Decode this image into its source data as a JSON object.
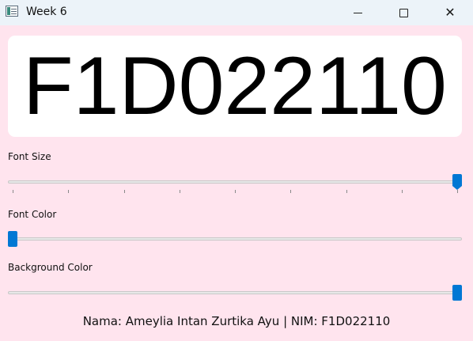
{
  "window": {
    "title": "Week 6",
    "icons": {
      "app": "app-window-icon",
      "minimize": "minimize-icon",
      "maximize": "maximize-icon",
      "close": "close-icon"
    },
    "close_glyph": "✕"
  },
  "display": {
    "text": "F1D022110",
    "text_color": "#000000",
    "background_color": "#ffffff"
  },
  "controls": {
    "font_size": {
      "label": "Font Size",
      "level": 1.0,
      "ticks": 9
    },
    "font_color": {
      "label": "Font Color",
      "level": 0.0
    },
    "background_color": {
      "label": "Background Color",
      "level": 1.0
    }
  },
  "footer": {
    "text": "Nama: Ameylia Intan Zurtika Ayu | NIM: F1D022110"
  },
  "colors": {
    "window_background": "#ffe4ee",
    "accent": "#0078d4",
    "titlebar": "#ecf3f9"
  }
}
